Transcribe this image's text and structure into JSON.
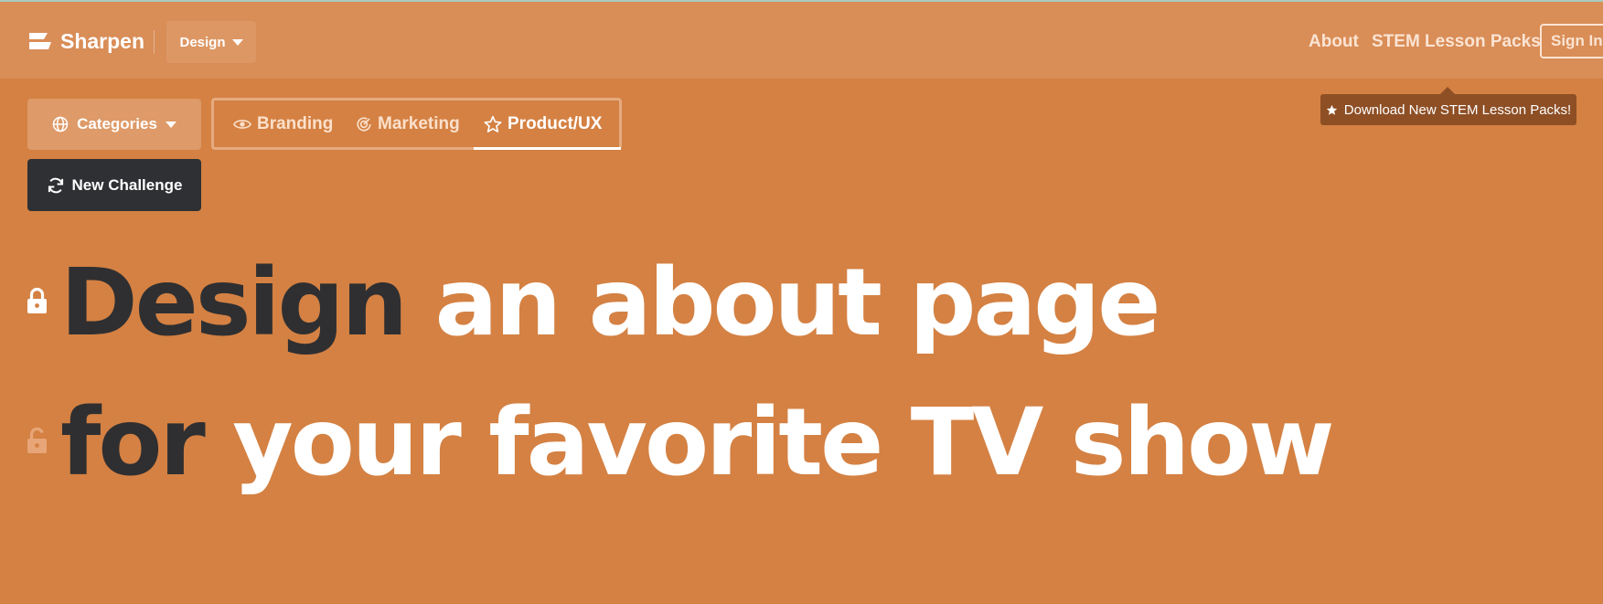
{
  "brand": {
    "name": "Sharpen"
  },
  "header": {
    "category_dropdown": "Design",
    "nav": [
      "About",
      "STEM Lesson Packs"
    ],
    "sign_in": "Sign In"
  },
  "tooltip": {
    "text": "Download New STEM Lesson Packs!",
    "icon": "star-icon"
  },
  "toolbar": {
    "categories_label": "Categories",
    "tabs": [
      {
        "label": "Branding",
        "icon": "eye-icon",
        "active": false
      },
      {
        "label": "Marketing",
        "icon": "target-icon",
        "active": false
      },
      {
        "label": "Product/UX",
        "icon": "star-outline-icon",
        "active": true
      }
    ],
    "new_challenge_label": "New Challenge"
  },
  "challenge": {
    "line1": {
      "keyword": "Design",
      "rest": "an about page",
      "locked": true
    },
    "line2": {
      "keyword": "for",
      "rest": "your favorite TV show",
      "locked": false
    }
  },
  "colors": {
    "background": "#d48143",
    "topbar": "#d98d57",
    "dark_text": "#2f2f31",
    "button_dark": "#2e3033",
    "tooltip": "#8e4f25"
  }
}
